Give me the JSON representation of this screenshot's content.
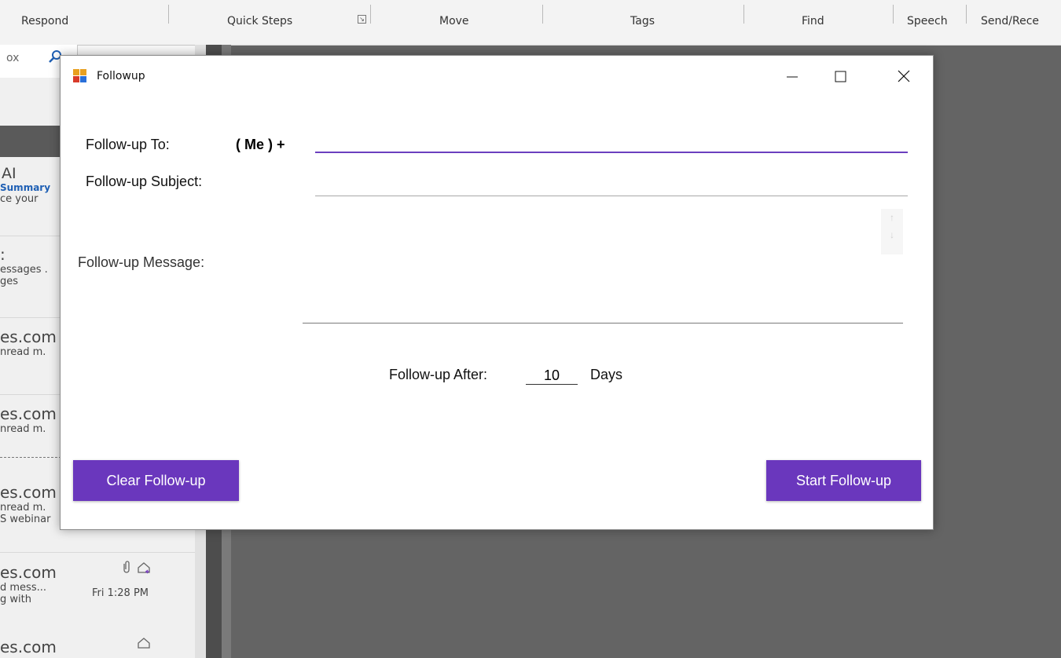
{
  "ribbon": {
    "groups": [
      "Respond",
      "Quick Steps",
      "Move",
      "Tags",
      "Find",
      "Speech",
      "Send/Rece"
    ]
  },
  "background_list": {
    "search_text": "ox",
    "messages": [
      {
        "from": "AI",
        "line1": "Summary",
        "line2": "ce your"
      },
      {
        "from": ":",
        "line1": "essages .",
        "line2": "ges"
      },
      {
        "from": "es.com",
        "line1": "nread m."
      },
      {
        "from": "es.com",
        "line1": "nread m."
      },
      {
        "from": "es.com",
        "line1": "nread m.",
        "line2": "S webinar"
      },
      {
        "from": "es.com",
        "line1": "d mess...",
        "line2": "g with",
        "time": "Fri 1:28 PM"
      },
      {
        "from": "es.com"
      }
    ]
  },
  "dialog": {
    "title": "Followup",
    "to_label": "Follow-up To:",
    "me_label": "( Me ) +",
    "to_value": "",
    "subject_label": "Follow-up Subject:",
    "subject_value": "",
    "message_label": "Follow-up Message:",
    "message_value": "",
    "after_label": "Follow-up After:",
    "after_value": "10",
    "days_label": "Days",
    "clear_button": "Clear Follow-up",
    "start_button": "Start Follow-up"
  },
  "colors": {
    "accent": "#6a37bd",
    "to_underline": "#6b3fbf"
  }
}
